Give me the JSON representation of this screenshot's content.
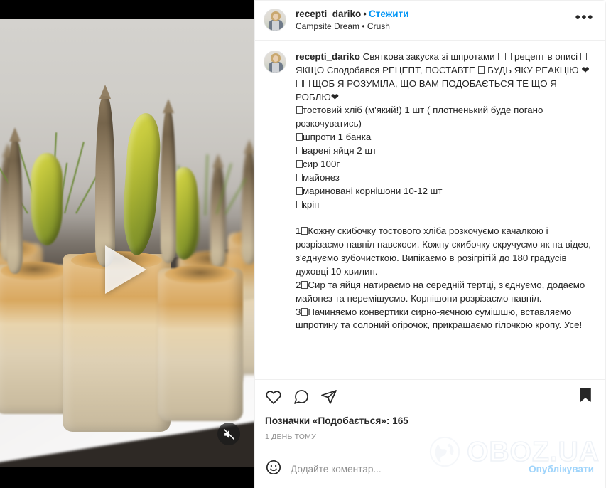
{
  "post": {
    "header": {
      "username": "recepti_dariko",
      "separator": "•",
      "follow_label": "Стежити",
      "audio_title": "Campsite Dream",
      "audio_artist": "Crush",
      "audio_separator": "•",
      "more_label": "•••",
      "avatar_name": "recepti_dariko"
    },
    "caption": {
      "username": "recepti_dariko",
      "text": "Святкова закуска зі шпротами ⬜⬜ рецепт в описі ⬜\nЯКЩО Сподобався РЕЦЕПТ, ПОСТАВТЕ ⬜ БУДЬ ЯКУ РЕАКЦІЮ ❤⬜⬜ ЩОБ Я РОЗУМІЛА, ЩО ВАМ ПОДОБАЄТЬСЯ ТЕ ЩО Я РОБЛЮ❤\n⬜тостовий хліб (м'який!) 1 шт ( плотненький буде погано розкочуватись)\n⬜шпроти 1 банка\n⬜варені яйця 2 шт\n⬜сир 100г\n⬜майонез\n⬜мариновані корнішони 10-12 шт\n⬜кріп\n\n1⬜Кожну скибочку тостового хліба розкочуємо качалкою і розрізаємо навпіл навскоси. Кожну скибочку скручуємо як на відео, з'єднуємо зубочисткою. Випікаємо в розігрітій до 180 градусів духовці 10 хвилин.\n2⬜Сир та яйця натираємо на середній тертці, з'єднуємо, додаємо майонез та перемішуємо. Корнішони розрізаємо навпіл.\n3⬜Начиняємо конвертики сирно-яєчною сумішшю, вставляємо шпротину та солоний огірочок, прикрашаємо гілочкою кропу. Усе!"
    },
    "actions": {
      "like_icon": "heart-icon",
      "comment_icon": "comment-bubble-icon",
      "share_icon": "share-paper-plane-icon",
      "save_icon": "bookmark-filled-icon",
      "likes_label": "Позначки «Подобається»: 165",
      "likes_count": 165,
      "timestamp": "1 ДЕНЬ ТОМУ"
    },
    "comment_bar": {
      "emoji_icon": "emoji-smiley-icon",
      "placeholder": "Додайте коментар...",
      "value": "",
      "post_label": "Опублікувати"
    },
    "media": {
      "type": "video",
      "play_icon": "play-triangle-icon",
      "mute_icon": "speaker-muted-icon",
      "muted": true
    }
  },
  "watermark": {
    "text": "OBOZ.UA",
    "icon": "globe-icon"
  },
  "colors": {
    "link_blue": "#0095f6",
    "post_blue_disabled": "#9fd4fb",
    "text_primary": "#262626",
    "text_secondary": "#8e8e8e",
    "divider": "#efefef",
    "watermark": "#eef2f7"
  }
}
